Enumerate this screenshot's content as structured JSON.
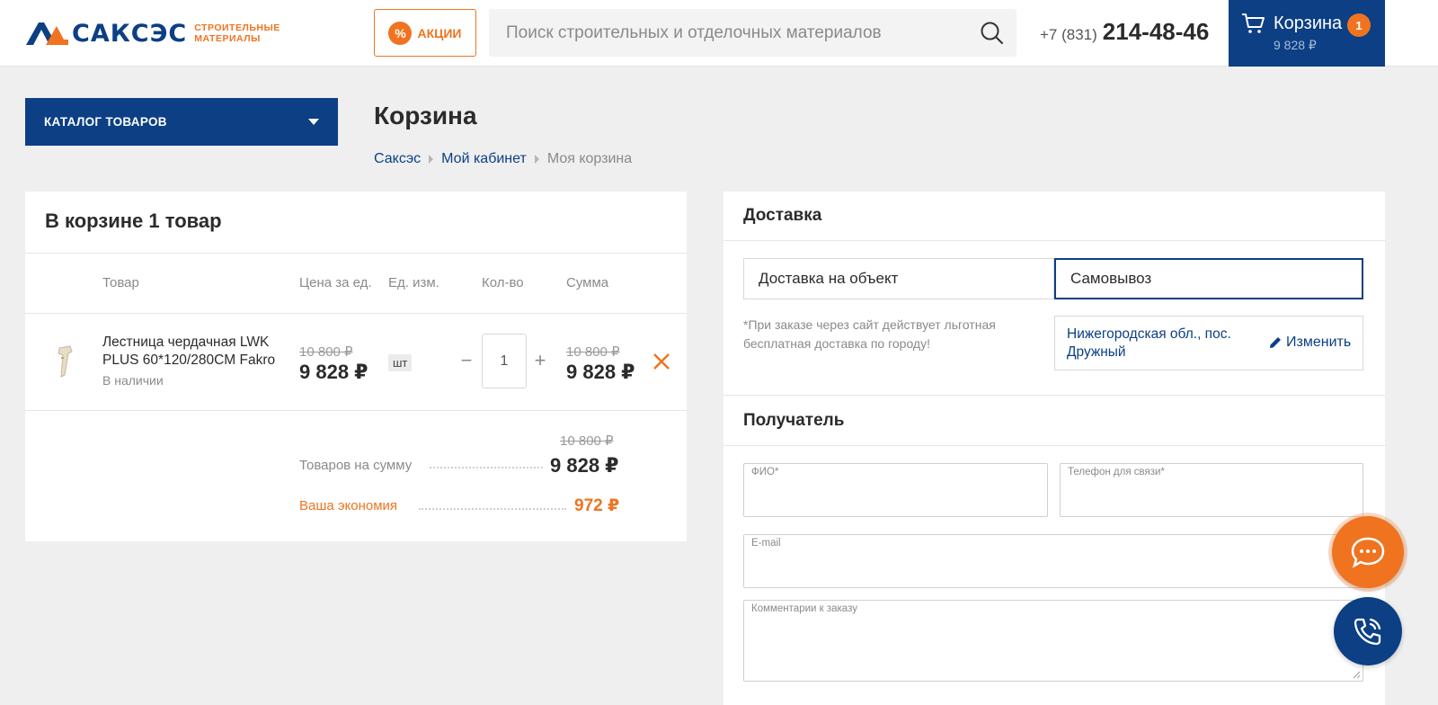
{
  "header": {
    "logo_text": "САКСЭС",
    "logo_sub_line1": "строительные",
    "logo_sub_line2": "материалы",
    "promo_icon": "%",
    "promo_label": "АКЦИИ",
    "search_placeholder": "Поиск строительных и отделочных материалов",
    "phone_code": "+7 (831)",
    "phone_number": "214-48-46",
    "cart_label": "Корзина",
    "cart_count": "1",
    "cart_total": "9 828 ₽"
  },
  "catalog": {
    "label": "КАТАЛОГ ТОВАРОВ"
  },
  "page": {
    "title": "Корзина",
    "breadcrumb": [
      "Саксэс",
      "Мой кабинет",
      "Моя корзина"
    ]
  },
  "cart": {
    "heading": "В корзине 1 товар",
    "columns": [
      "Товар",
      "Цена за ед.",
      "Ед. изм.",
      "Кол-во",
      "Сумма"
    ],
    "item": {
      "name": "Лестница чердачная LWK PLUS 60*120/280CM Fakro",
      "stock": "В наличии",
      "price_old": "10 800 ₽",
      "price_new": "9 828 ₽",
      "unit": "шт",
      "qty": "1",
      "qty_minus": "−",
      "qty_plus": "+",
      "sum_old": "10 800 ₽",
      "sum_new": "9 828 ₽"
    },
    "totals": {
      "old": "10 800 ₽",
      "label": "Товаров на сумму",
      "value": "9 828 ₽",
      "savings_label": "Ваша экономия",
      "savings_value": "972 ₽"
    }
  },
  "delivery": {
    "title": "Доставка",
    "tabs": [
      "Доставка на объект",
      "Самовывоз"
    ],
    "selected_tab": "Самовывоз",
    "note": "*При заказе через сайт действует льготная бесплатная доставка по городу!",
    "address": "Нижегородская обл., пос. Дружный",
    "edit_label": "Изменить"
  },
  "recipient": {
    "title": "Получатель",
    "fields": {
      "name": "ФИО*",
      "phone": "Телефон для связи*",
      "email": "E-mail",
      "comment": "Комментарии к заказу"
    }
  },
  "colors": {
    "brand_blue": "#0c3f84",
    "accent_orange": "#f07320"
  },
  "icons": {
    "search": "search-icon",
    "cart": "cart-icon",
    "remove": "close-icon",
    "edit": "pencil-icon",
    "chat": "chat-icon",
    "call": "phone-icon"
  }
}
